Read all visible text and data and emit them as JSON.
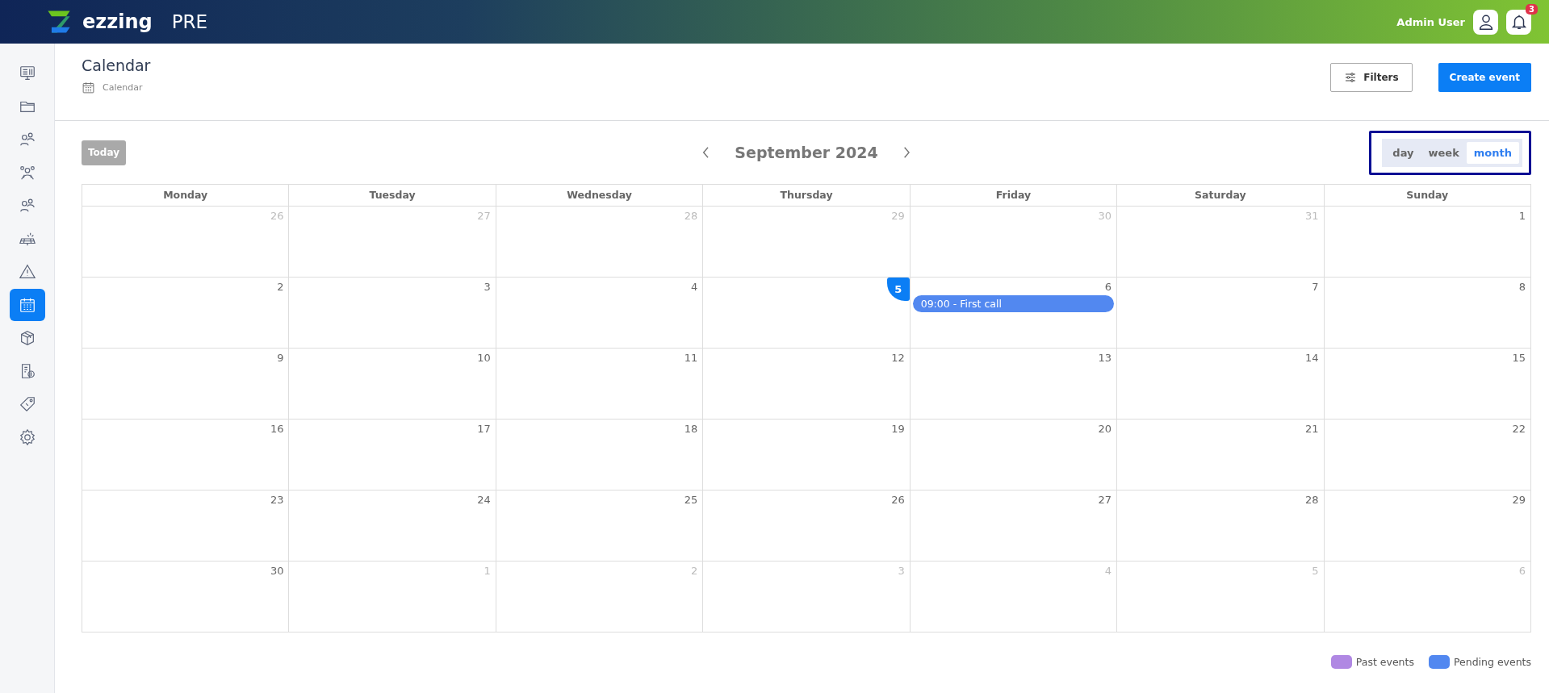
{
  "header": {
    "brand": "ezzing",
    "env": "PRE",
    "user": "Admin User",
    "notifications": "3"
  },
  "sidebar": {
    "items": [
      {
        "kind": "monitor",
        "selected": false
      },
      {
        "kind": "folder",
        "selected": false
      },
      {
        "kind": "users",
        "selected": false
      },
      {
        "kind": "team",
        "selected": false
      },
      {
        "kind": "users",
        "selected": false
      },
      {
        "kind": "solar",
        "selected": false
      },
      {
        "kind": "warning",
        "selected": false
      },
      {
        "kind": "calendar",
        "selected": true
      },
      {
        "kind": "box",
        "selected": false
      },
      {
        "kind": "invoice",
        "selected": false
      },
      {
        "kind": "tag",
        "selected": false
      },
      {
        "kind": "gear",
        "selected": false
      }
    ]
  },
  "page": {
    "title": "Calendar",
    "breadcrumb": "Calendar",
    "filters_button": "Filters",
    "create_button": "Create event"
  },
  "toolbar": {
    "today_button": "Today",
    "today_disabled": true,
    "month": "September 2024",
    "views": [
      {
        "label": "day",
        "selected": false
      },
      {
        "label": "week",
        "selected": false
      },
      {
        "label": "month",
        "selected": true
      }
    ]
  },
  "calendar": {
    "weekdays": [
      "Monday",
      "Tuesday",
      "Wednesday",
      "Thursday",
      "Friday",
      "Saturday",
      "Sunday"
    ],
    "weeks": [
      [
        {
          "day": "26",
          "other_month": true
        },
        {
          "day": "27",
          "other_month": true
        },
        {
          "day": "28",
          "other_month": true
        },
        {
          "day": "29",
          "other_month": true
        },
        {
          "day": "30",
          "other_month": true
        },
        {
          "day": "31",
          "other_month": true
        },
        {
          "day": "1",
          "other_month": false
        }
      ],
      [
        {
          "day": "2",
          "other_month": false
        },
        {
          "day": "3",
          "other_month": false
        },
        {
          "day": "4",
          "other_month": false
        },
        {
          "day": "5",
          "other_month": false,
          "today": true
        },
        {
          "day": "6",
          "other_month": false,
          "events": [
            {
              "label": "09:00 - First call",
              "color": "#5288f0"
            }
          ]
        },
        {
          "day": "7",
          "other_month": false
        },
        {
          "day": "8",
          "other_month": false
        }
      ],
      [
        {
          "day": "9",
          "other_month": false
        },
        {
          "day": "10",
          "other_month": false
        },
        {
          "day": "11",
          "other_month": false
        },
        {
          "day": "12",
          "other_month": false
        },
        {
          "day": "13",
          "other_month": false
        },
        {
          "day": "14",
          "other_month": false
        },
        {
          "day": "15",
          "other_month": false
        }
      ],
      [
        {
          "day": "16",
          "other_month": false
        },
        {
          "day": "17",
          "other_month": false
        },
        {
          "day": "18",
          "other_month": false
        },
        {
          "day": "19",
          "other_month": false
        },
        {
          "day": "20",
          "other_month": false
        },
        {
          "day": "21",
          "other_month": false
        },
        {
          "day": "22",
          "other_month": false
        }
      ],
      [
        {
          "day": "23",
          "other_month": false
        },
        {
          "day": "24",
          "other_month": false
        },
        {
          "day": "25",
          "other_month": false
        },
        {
          "day": "26",
          "other_month": false
        },
        {
          "day": "27",
          "other_month": false
        },
        {
          "day": "28",
          "other_month": false
        },
        {
          "day": "29",
          "other_month": false
        }
      ],
      [
        {
          "day": "30",
          "other_month": false
        },
        {
          "day": "1",
          "other_month": true
        },
        {
          "day": "2",
          "other_month": true
        },
        {
          "day": "3",
          "other_month": true
        },
        {
          "day": "4",
          "other_month": true
        },
        {
          "day": "5",
          "other_month": true
        },
        {
          "day": "6",
          "other_month": true
        }
      ]
    ]
  },
  "legend": [
    {
      "label": "Past events",
      "color": "#b088e3"
    },
    {
      "label": "Pending events",
      "color": "#5288f0"
    }
  ]
}
